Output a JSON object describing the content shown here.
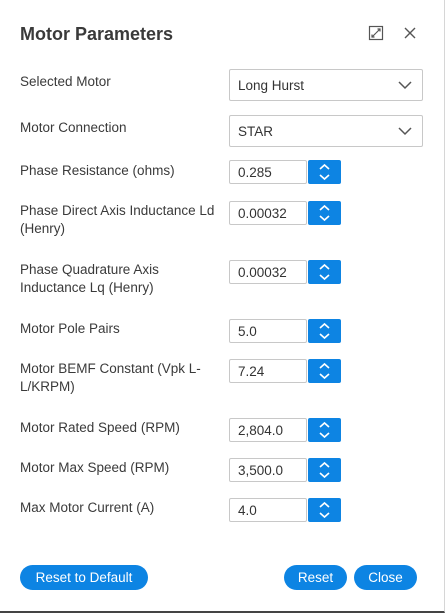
{
  "dialog": {
    "title": "Motor Parameters",
    "icons": {
      "expand": "expand-icon",
      "close": "close-icon"
    },
    "accent_color": "#0d84e3"
  },
  "fields": {
    "selected_motor": {
      "label": "Selected Motor",
      "value": "Long Hurst"
    },
    "motor_connection": {
      "label": "Motor Connection",
      "value": "STAR"
    },
    "phase_resistance": {
      "label": "Phase Resistance (ohms)",
      "value": "0.285"
    },
    "phase_direct_inductance": {
      "label": "Phase Direct Axis Inductance Ld (Henry)",
      "value": "0.00032"
    },
    "phase_quadrature_inductance": {
      "label": "Phase Quadrature Axis Inductance Lq (Henry)",
      "value": "0.00032"
    },
    "motor_pole_pairs": {
      "label": "Motor Pole Pairs",
      "value": "5.0"
    },
    "motor_bemf_constant": {
      "label": "Motor BEMF Constant (Vpk L-L/KRPM)",
      "value": "7.24"
    },
    "motor_rated_speed": {
      "label": "Motor Rated Speed (RPM)",
      "value": "2,804.0"
    },
    "motor_max_speed": {
      "label": "Motor Max Speed (RPM)",
      "value": "3,500.0"
    },
    "max_motor_current": {
      "label": "Max Motor Current (A)",
      "value": "4.0"
    }
  },
  "buttons": {
    "reset_default": "Reset to Default",
    "reset": "Reset",
    "close": "Close"
  }
}
